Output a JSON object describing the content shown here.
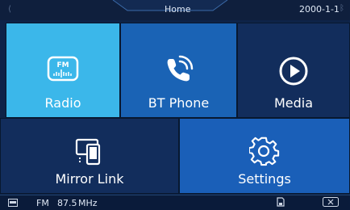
{
  "header": {
    "title": "Home",
    "date": "2000-1-1",
    "left_icon": "phone-signal-icon",
    "right_icon": "bluetooth-icon"
  },
  "tiles": [
    {
      "id": "radio",
      "label": "Radio",
      "icon": "fm-radio-icon",
      "color": "#3bb7ea"
    },
    {
      "id": "bt-phone",
      "label": "BT Phone",
      "icon": "phone-call-icon",
      "color": "#1a63b5"
    },
    {
      "id": "media",
      "label": "Media",
      "icon": "play-circle-icon",
      "color": "#122d5c"
    },
    {
      "id": "mirror-link",
      "label": "Mirror Link",
      "icon": "mirror-devices-icon",
      "color": "#122d5c"
    },
    {
      "id": "settings",
      "label": "Settings",
      "icon": "gear-icon",
      "color": "#1a5fb8"
    }
  ],
  "status": {
    "band": "FM",
    "frequency": "87.5",
    "unit": "MHz",
    "left_icon": "radio-source-icon",
    "mid_icon": "sd-card-icon",
    "right_icon": "close-icon"
  }
}
